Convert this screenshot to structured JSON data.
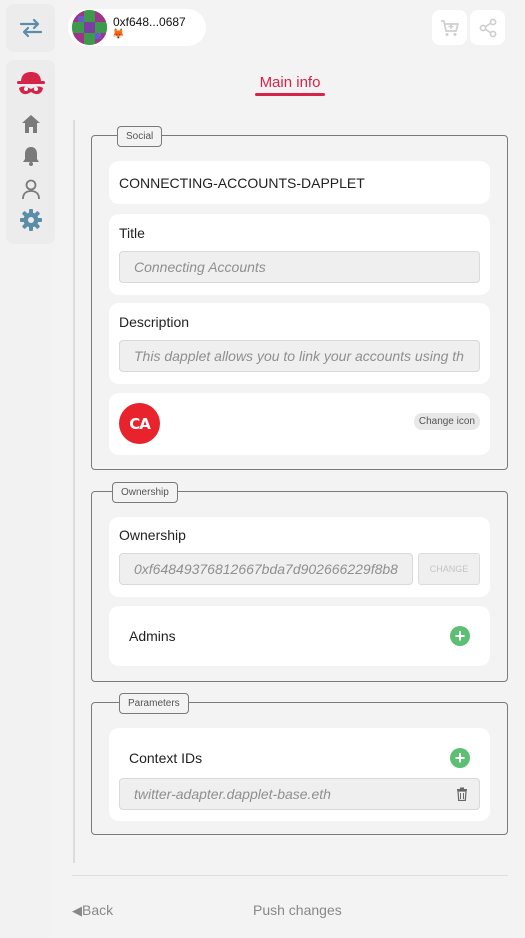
{
  "account": {
    "address": "0xf648...0687",
    "wallet_icon": "🦊"
  },
  "tabs": {
    "main_info": "Main info"
  },
  "social": {
    "legend": "Social",
    "name": "CONNECTING-ACCOUNTS-DAPPLET",
    "title_label": "Title",
    "title_placeholder": "Connecting Accounts",
    "description_label": "Description",
    "description_placeholder": "This dapplet allows you to link your accounts using th",
    "icon_text": "CA",
    "change_icon_label": "Change icon"
  },
  "ownership": {
    "legend": "Ownership",
    "label": "Ownership",
    "address_placeholder": "0xf64849376812667bda7d902666229f8b8",
    "change_label": "CHANGE",
    "admins_label": "Admins"
  },
  "parameters": {
    "legend": "Parameters",
    "context_ids_label": "Context IDs",
    "context_id_value": "twitter-adapter.dapplet-base.eth"
  },
  "footer": {
    "back_label": "Back",
    "push_label": "Push changes"
  },
  "colors": {
    "accent": "#d6234a",
    "add_green": "#5cbf73",
    "nav_blue": "#5b8da8",
    "icon_grey": "#7a7a7a"
  }
}
